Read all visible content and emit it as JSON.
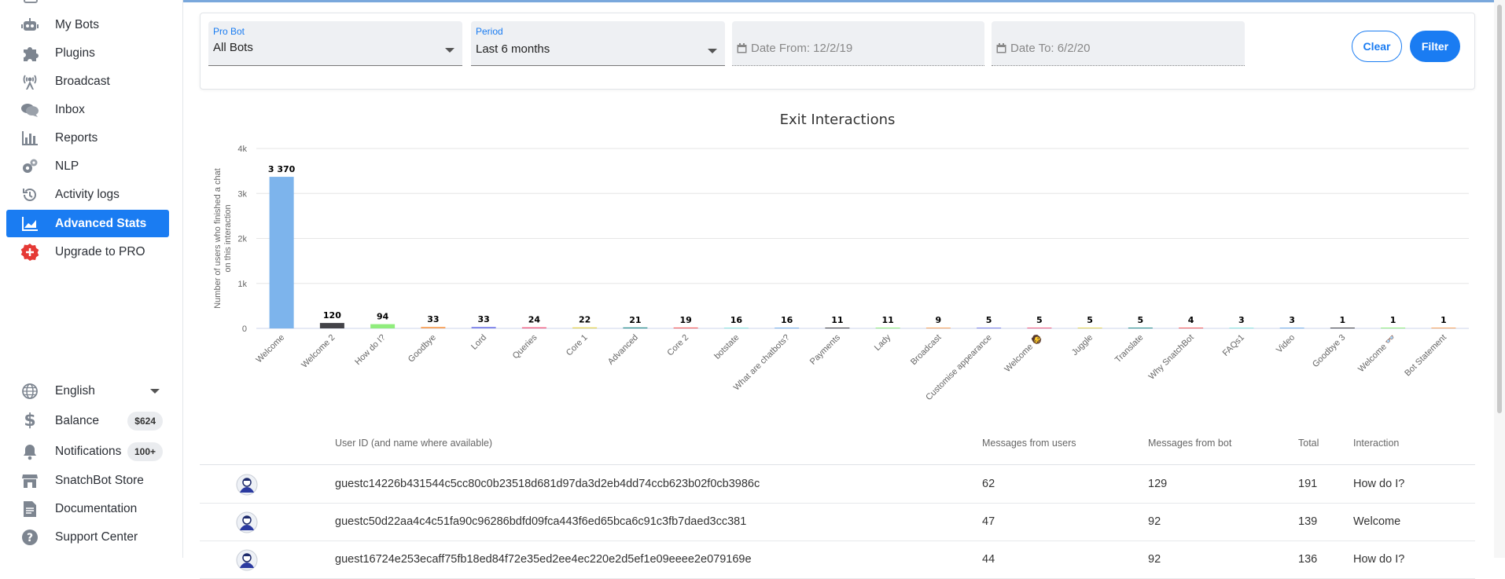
{
  "sidebar": {
    "items": [
      {
        "label": "My Bots",
        "icon": "robot-icon"
      },
      {
        "label": "Plugins",
        "icon": "puzzle-icon"
      },
      {
        "label": "Broadcast",
        "icon": "broadcast-icon"
      },
      {
        "label": "Inbox",
        "icon": "chat-icon"
      },
      {
        "label": "Reports",
        "icon": "bar-chart-icon"
      },
      {
        "label": "NLP",
        "icon": "gears-icon"
      },
      {
        "label": "Activity logs",
        "icon": "history-icon"
      },
      {
        "label": "Advanced Stats",
        "icon": "area-chart-icon"
      },
      {
        "label": "Upgrade to PRO",
        "icon": "plus-circle-icon"
      }
    ],
    "bottom": {
      "language": "English",
      "balance_label": "Balance",
      "balance_value": "$624",
      "notifications_label": "Notifications",
      "notifications_count": "100+",
      "store": "SnatchBot Store",
      "documentation": "Documentation",
      "support": "Support Center"
    }
  },
  "filters": {
    "probot_label": "Pro Bot",
    "probot_value": "All Bots",
    "period_label": "Period",
    "period_value": "Last 6 months",
    "date_from": "Date From: 12/2/19",
    "date_to": "Date To: 6/2/20",
    "clear": "Clear",
    "filter": "Filter"
  },
  "chart_data": {
    "type": "bar",
    "title": "Exit Interactions",
    "ylabel": "Number of users who finished a chat on this interaction",
    "ylim": [
      0,
      4000
    ],
    "yticks": [
      "0",
      "1k",
      "2k",
      "3k",
      "4k"
    ],
    "categories": [
      "Welcome",
      "Welcome 2",
      "How do I?",
      "Goodbye",
      "Lord",
      "Queries",
      "Core 1",
      "Advanced",
      "Core 2",
      "botstate",
      "What are chatbots?",
      "Payments",
      "Lady",
      "Broadcast",
      "Customise appearance",
      "Welcome 🧔",
      "Juggle",
      "Translate",
      "Why SnatchBot",
      "FAQs1",
      "Video",
      "Goodbye 3",
      "Welcome 👓",
      "Bot Statement"
    ],
    "values": [
      3370,
      120,
      94,
      33,
      33,
      24,
      22,
      21,
      19,
      16,
      16,
      11,
      11,
      9,
      5,
      5,
      5,
      5,
      4,
      3,
      3,
      1,
      1,
      1
    ],
    "value_labels": [
      "3 370",
      "120",
      "94",
      "33",
      "33",
      "24",
      "22",
      "21",
      "19",
      "16",
      "16",
      "11",
      "11",
      "9",
      "5",
      "5",
      "5",
      "5",
      "4",
      "3",
      "3",
      "1",
      "1",
      "1"
    ],
    "colors": [
      "#7db4ec",
      "#434348",
      "#90ed7d",
      "#f7a35c",
      "#8085e9",
      "#f15c80",
      "#e4d354",
      "#2b908f",
      "#f45b5b",
      "#91e8e1",
      "#7db4ec",
      "#434348",
      "#90ed7d",
      "#f7a35c",
      "#8085e9",
      "#f15c80",
      "#e4d354",
      "#2b908f",
      "#f45b5b",
      "#91e8e1",
      "#7db4ec",
      "#434348",
      "#90ed7d",
      "#f7a35c"
    ],
    "grid": true,
    "legend": "none"
  },
  "table": {
    "headers": [
      "User ID (and name where available)",
      "Messages from users",
      "Messages from bot",
      "Total",
      "Interaction"
    ],
    "rows": [
      {
        "user": "guestc14226b431544c5cc80c0b23518d681d97da3d2eb4dd74ccb623b02f0cb3986c",
        "from_users": "62",
        "from_bot": "129",
        "total": "191",
        "interaction": "How do I?"
      },
      {
        "user": "guestc50d22aa4c4c51fa90c96286bdfd09fca443f6ed65bca6c91c3fb7daed3cc381",
        "from_users": "47",
        "from_bot": "92",
        "total": "139",
        "interaction": "Welcome"
      },
      {
        "user": "guest16724e253ecaff75fb18ed84f72e35ed2ee4ec220e2d5ef1e09eeee2e079169e",
        "from_users": "44",
        "from_bot": "92",
        "total": "136",
        "interaction": "How do I?"
      }
    ]
  }
}
